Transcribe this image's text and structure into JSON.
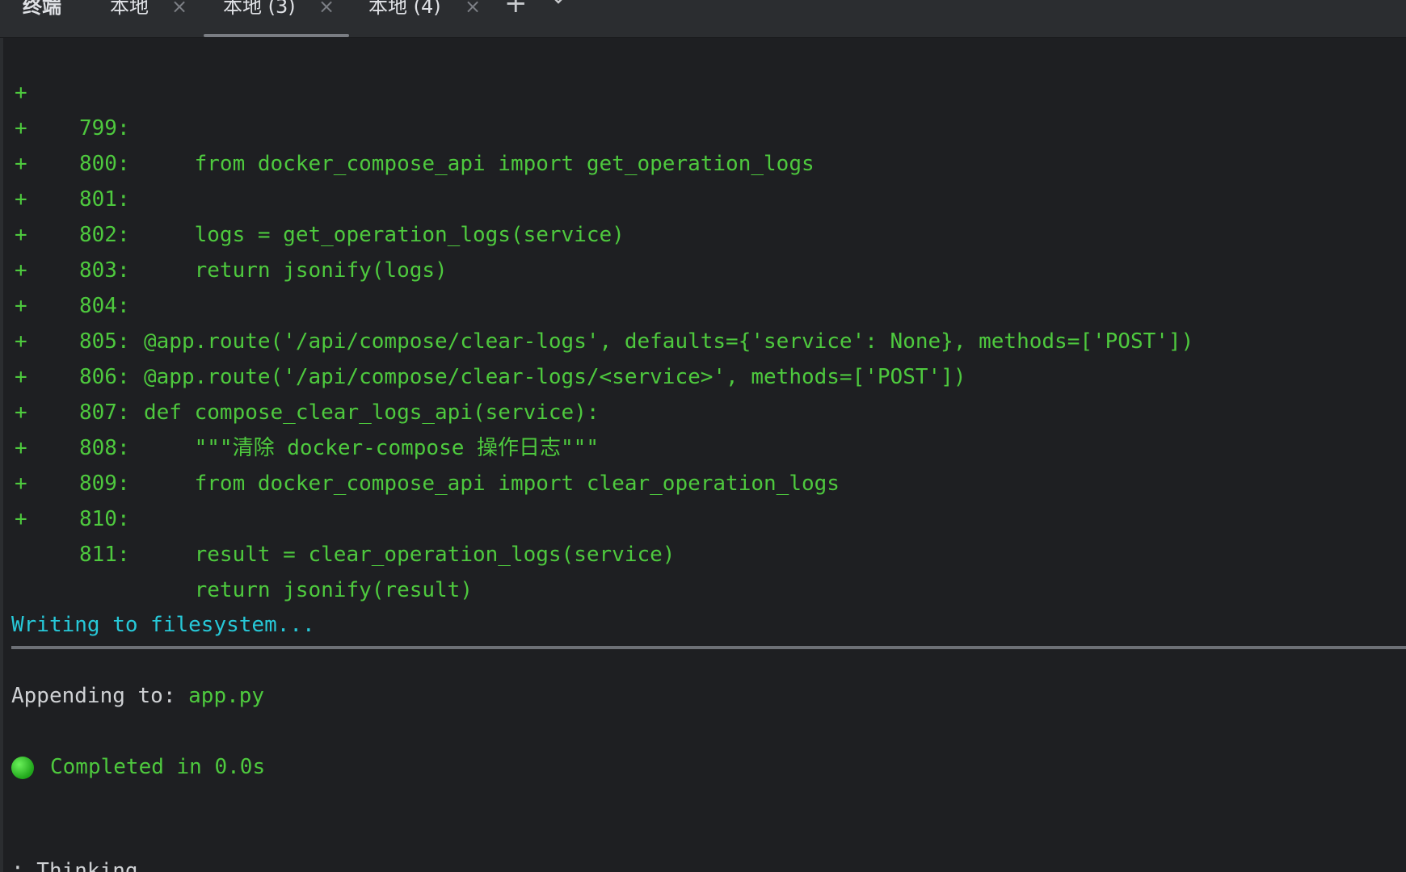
{
  "tabs": {
    "title": "终端",
    "items": [
      {
        "label": "本地"
      },
      {
        "label": "本地 (3)",
        "active": true
      },
      {
        "label": "本地 (4)"
      }
    ],
    "close_glyph": "×",
    "add_glyph": "+",
    "menu_icon": "chevron-down-icon"
  },
  "diff": {
    "marker": "+",
    "lines": [
      {
        "no": "799:",
        "code": "    from docker_compose_api import get_operation_logs"
      },
      {
        "no": "800:",
        "code": ""
      },
      {
        "no": "801:",
        "code": "    logs = get_operation_logs(service)"
      },
      {
        "no": "802:",
        "code": "    return jsonify(logs)"
      },
      {
        "no": "803:",
        "code": ""
      },
      {
        "no": "804:",
        "code": "@app.route('/api/compose/clear-logs', defaults={'service': None}, methods=['POST'])"
      },
      {
        "no": "805:",
        "code": "@app.route('/api/compose/clear-logs/<service>', methods=['POST'])"
      },
      {
        "no": "806:",
        "code": "def compose_clear_logs_api(service):"
      },
      {
        "no": "807:",
        "code": "    \"\"\"清除 docker-compose 操作日志\"\"\""
      },
      {
        "no": "808:",
        "code": "    from docker_compose_api import clear_operation_logs"
      },
      {
        "no": "809:",
        "code": ""
      },
      {
        "no": "810:",
        "code": "    result = clear_operation_logs(service)"
      },
      {
        "no": "811:",
        "code": "    return jsonify(result)"
      }
    ]
  },
  "status": {
    "writing": "Writing to filesystem...",
    "append_label": "Appending to: ",
    "append_file": "app.py",
    "completed": "Completed in 0.0s",
    "thinking": "∴ Thinking"
  },
  "colors": {
    "diff_green": "#4ec93e",
    "writing_cyan": "#27c8d8",
    "background": "#1e1f22",
    "tabbar": "#2b2d30"
  }
}
